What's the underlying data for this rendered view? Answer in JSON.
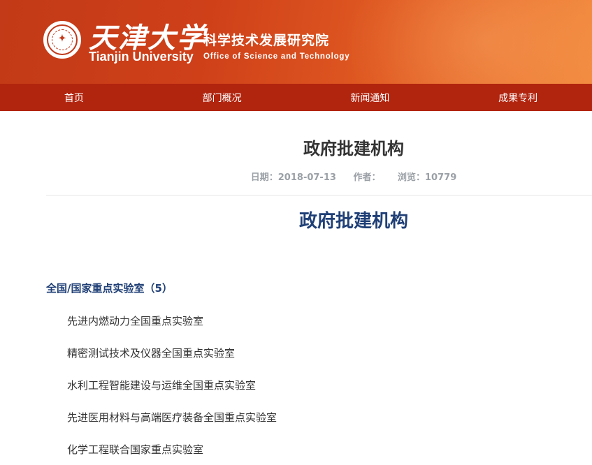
{
  "header": {
    "brand_cn": "天津大学",
    "brand_en": "Tianjin University",
    "dept_cn": "科学技术发展研究院",
    "dept_en": "Office of Science and Technology"
  },
  "nav": {
    "items": [
      {
        "label": "首页"
      },
      {
        "label": "部门概况"
      },
      {
        "label": "新闻通知"
      },
      {
        "label": "成果专利"
      }
    ]
  },
  "article": {
    "title": "政府批建机构",
    "meta": {
      "date_label": "日期：",
      "date": "2018-07-13",
      "author_label": "作者：",
      "author": "",
      "views_label": "浏览：",
      "views": "10779"
    },
    "sub_title": "政府批建机构",
    "section_heading": "全国/国家重点实验室（5）",
    "labs": [
      "先进内燃动力全国重点实验室",
      "精密测试技术及仪器全国重点实验室",
      "水利工程智能建设与运维全国重点实验室",
      "先进医用材料与高端医疗装备全国重点实验室",
      "化学工程联合国家重点实验室"
    ]
  }
}
